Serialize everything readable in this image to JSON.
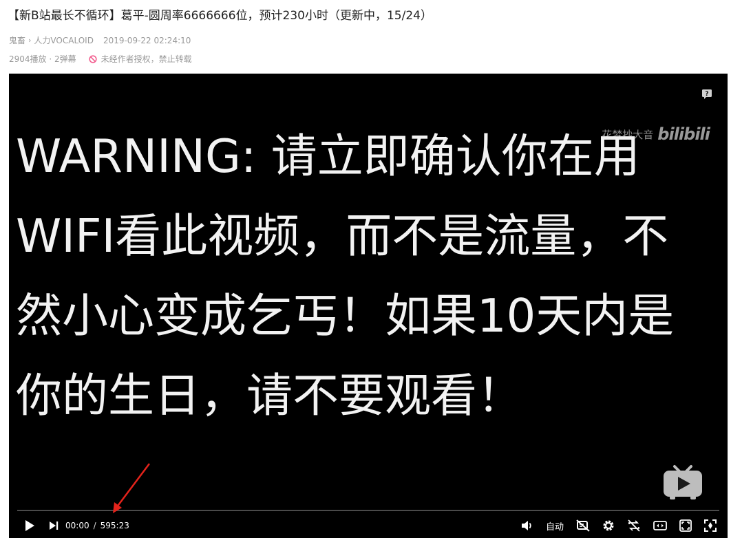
{
  "video": {
    "title": "【新B站最长不循环】葛平-圆周率6666666位，预计230小时（更新中，15/24）",
    "category_parent": "鬼畜",
    "category_child": "人力VOCALOID",
    "publish_time": "2019-09-22 02:24:10",
    "stats": "2904播放 · 2弹幕",
    "copyright_notice": "未经作者授权，禁止转载"
  },
  "player": {
    "watermark_text": "花梦抄大音",
    "watermark_logo": "bilibili",
    "warning_text": "WARNING: 请立即确认你在用\nWIFI看此视频，而不是流量，不\n然小心变成乞丐！如果10天内是\n你的生日，请不要观看！",
    "current_time": "00:00",
    "time_separator": "/",
    "duration": "595:23",
    "progress_fraction": 0,
    "quality_label": "自动"
  },
  "icons": {
    "play": "play-icon",
    "next": "next-icon",
    "volume": "volume-icon",
    "danmaku_off": "danmaku-off-icon",
    "settings": "gear-icon",
    "loop": "loop-icon",
    "widescreen": "widescreen-icon",
    "web_fullscreen": "web-fullscreen-icon",
    "fullscreen": "fullscreen-icon",
    "help": "help-icon",
    "tv": "bilibili-tv-icon",
    "forbidden": "forbidden-icon"
  },
  "colors": {
    "annotation_arrow": "#e3231b",
    "forbidden_icon": "#f25d8e",
    "player_bg": "#000000"
  }
}
